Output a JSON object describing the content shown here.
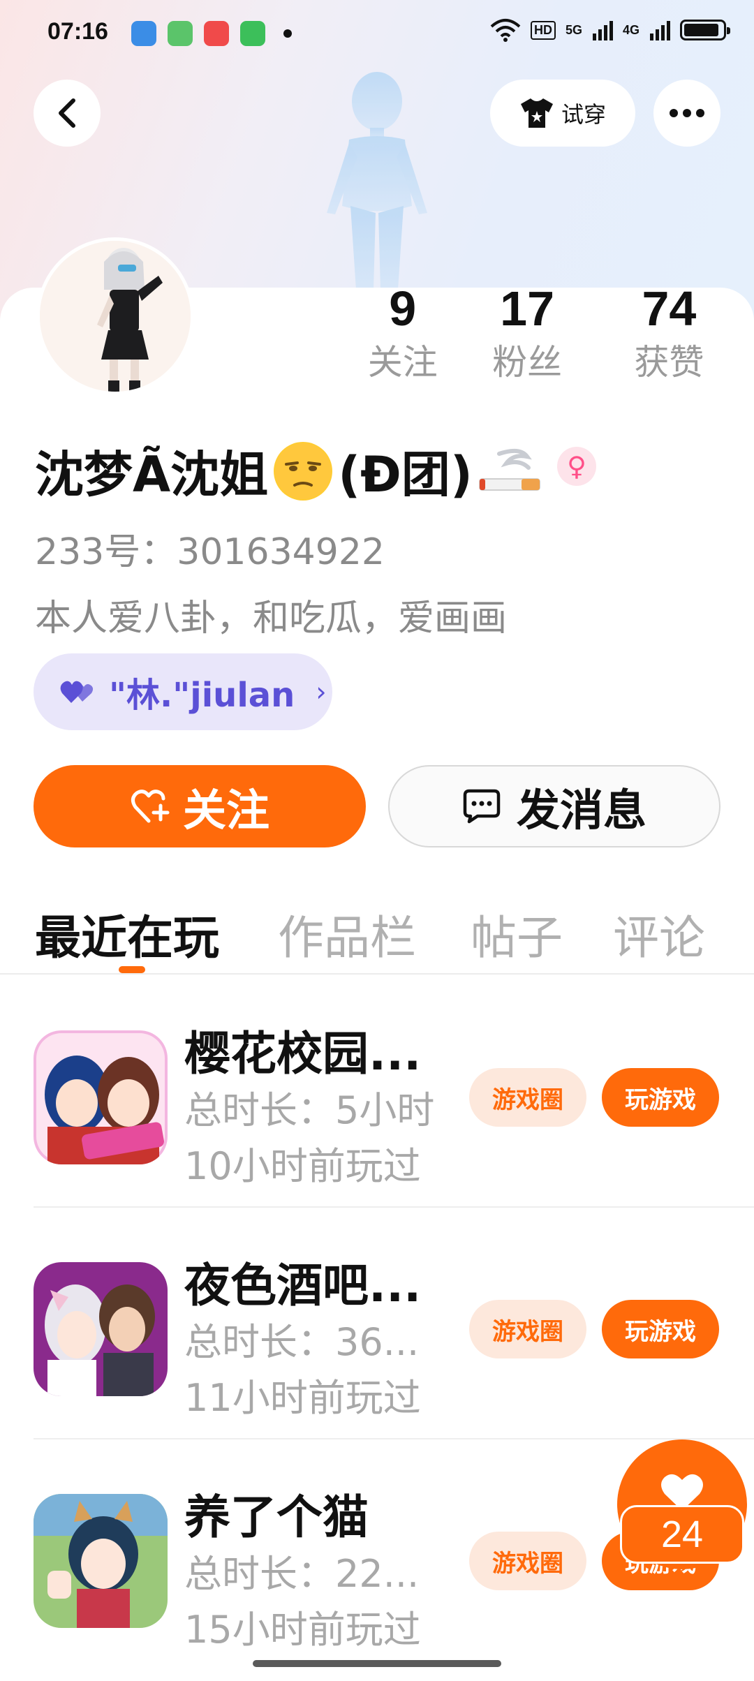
{
  "status_bar": {
    "time": "07:16",
    "hd": "HD",
    "net1": "5G",
    "net2": "4G",
    "battery_level": 0.9
  },
  "top_nav": {
    "tryon_label": "试穿"
  },
  "stats": [
    {
      "count": "9",
      "label": "关注"
    },
    {
      "count": "17",
      "label": "粉丝"
    },
    {
      "count": "74",
      "label": "获赞"
    }
  ],
  "profile": {
    "nickname_a": "沈梦Ã沈姐",
    "nickname_b": "(Đ团)",
    "gender_icon": "♀",
    "uid": "233号：301634922",
    "bio": "本人爱八卦，和吃瓜，爱画画",
    "cp_name": "\"林.\"jiulan"
  },
  "actions": {
    "follow_label": "关注",
    "message_label": "发消息"
  },
  "tabs": [
    "最近在玩",
    "作品栏",
    "帖子",
    "评论"
  ],
  "games": [
    {
      "title": "樱花校园...",
      "duration": "总时长：5小时",
      "last_played": "10小时前玩过",
      "circle_label": "游戏圈",
      "play_label": "玩游戏"
    },
    {
      "title": "夜色酒吧...",
      "duration": "总时长：36...",
      "last_played": "11小时前玩过",
      "circle_label": "游戏圈",
      "play_label": "玩游戏"
    },
    {
      "title": "养了个猫",
      "duration": "总时长：22...",
      "last_played": "15小时前玩过",
      "circle_label": "游戏圈",
      "play_label": "玩游戏"
    }
  ],
  "like_fab": {
    "count": "24"
  },
  "colors": {
    "accent": "#ff6a0b",
    "cp_chip_bg": "#e9e6fa",
    "cp_chip_text": "#5b50d6"
  }
}
